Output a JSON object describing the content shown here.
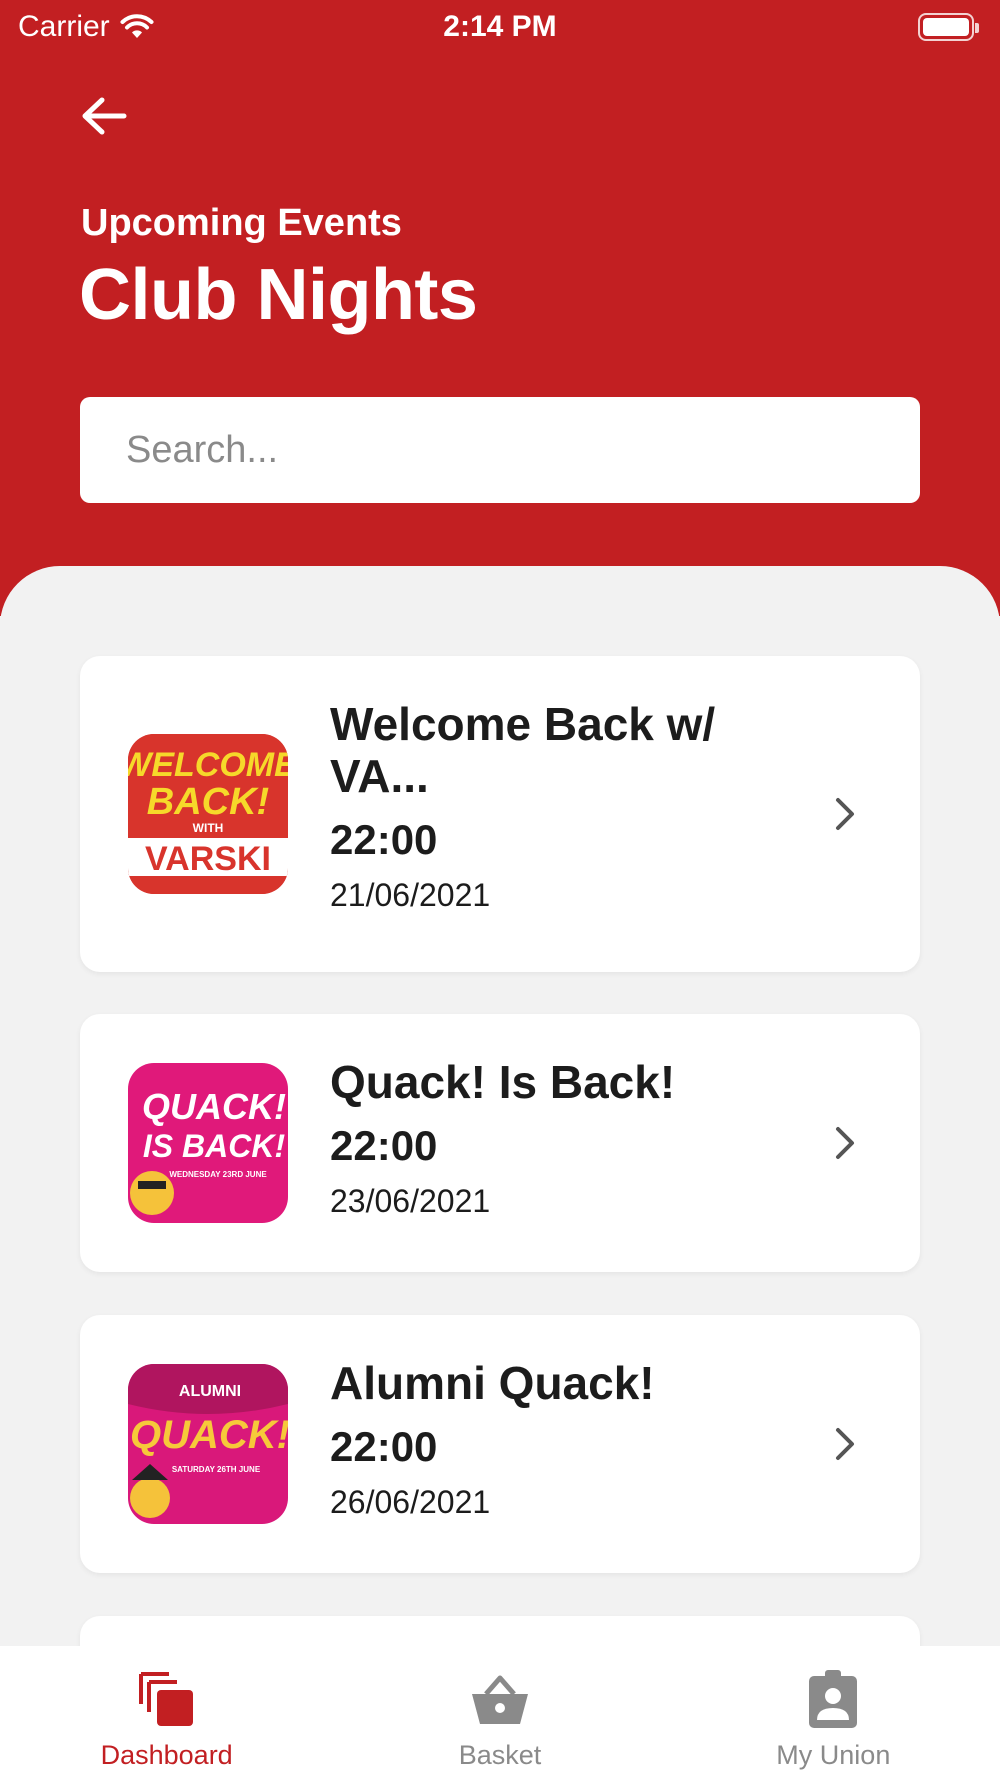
{
  "status_bar": {
    "carrier": "Carrier",
    "time": "2:14 PM"
  },
  "header": {
    "subtitle": "Upcoming Events",
    "title": "Club Nights",
    "accent_color": "#c21f22"
  },
  "search": {
    "placeholder": "Search...",
    "value": ""
  },
  "events": [
    {
      "title": "Welcome Back w/ VA...",
      "time": "22:00",
      "date": "21/06/2021",
      "thumbnail": {
        "line1": "WELCOME",
        "line2": "BACK!",
        "line3": "WITH",
        "line4": "VARSKI"
      }
    },
    {
      "title": "Quack! Is Back!",
      "time": "22:00",
      "date": "23/06/2021",
      "thumbnail": {
        "line1": "QUACK!",
        "line2": "IS BACK!",
        "line3": "WEDNESDAY 23RD JUNE"
      }
    },
    {
      "title": "Alumni Quack!",
      "time": "22:00",
      "date": "26/06/2021",
      "thumbnail": {
        "line1": "ALUMNI",
        "line2": "QUACK!",
        "line3": "SATURDAY 26TH JUNE"
      }
    }
  ],
  "tabs": [
    {
      "label": "Dashboard",
      "icon": "dashboard-icon",
      "active": true
    },
    {
      "label": "Basket",
      "icon": "basket-icon",
      "active": false
    },
    {
      "label": "My Union",
      "icon": "member-card-icon",
      "active": false
    }
  ]
}
